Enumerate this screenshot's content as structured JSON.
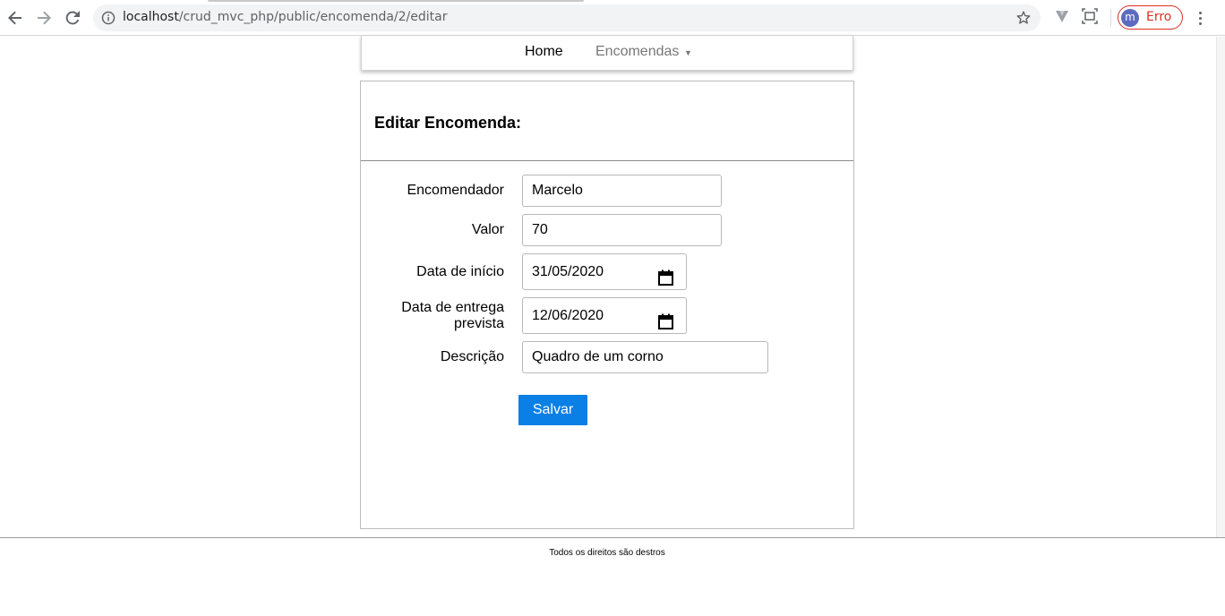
{
  "browser": {
    "url_host": "localhost",
    "url_path": "/crud_mvc_php/public/encomenda/2/editar",
    "profile_initial": "m",
    "profile_label": "Erro",
    "icons": [
      "back-arrow-icon",
      "forward-arrow-icon",
      "reload-icon",
      "info-icon",
      "star-icon",
      "extension-icon",
      "screenshot-icon",
      "menu-icon"
    ]
  },
  "nav": {
    "home": "Home",
    "encomendas": "Encomendas",
    "caret": "▼"
  },
  "form": {
    "title": "Editar Encomenda:",
    "fields": [
      {
        "label": "Encomendador",
        "value": "Marcelo"
      },
      {
        "label": "Valor",
        "value": "70"
      },
      {
        "label": "Data de início",
        "value": "31/05/2020"
      },
      {
        "label_line1": "Data de entrega",
        "label_line2": "prevista",
        "value": "12/06/2020"
      },
      {
        "label": "Descrição",
        "value": "Quadro de um corno"
      }
    ],
    "submit": "Salvar"
  },
  "footer": {
    "text": "Todos os direitos são destros"
  },
  "colors": {
    "accent": "#0a7fe6",
    "error": "#d93025"
  }
}
